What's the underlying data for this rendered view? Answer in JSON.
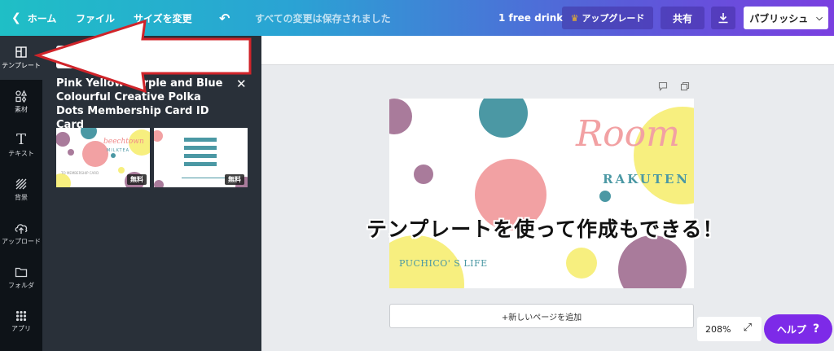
{
  "topbar": {
    "home": "ホーム",
    "file": "ファイル",
    "resize": "サイズを変更",
    "saved_status": "すべての変更は保存されました",
    "free_drink": "1 free drink",
    "upgrade": "アップグレード",
    "share": "共有",
    "publish": "パブリッシュ"
  },
  "rail": {
    "items": [
      {
        "label": "テンプレート",
        "icon": "template-icon"
      },
      {
        "label": "素材",
        "icon": "elements-icon"
      },
      {
        "label": "テキスト",
        "icon": "text-icon"
      },
      {
        "label": "背景",
        "icon": "background-icon"
      },
      {
        "label": "アップロード",
        "icon": "upload-icon"
      },
      {
        "label": "フォルダ",
        "icon": "folder-icon"
      },
      {
        "label": "アプリ",
        "icon": "apps-icon"
      }
    ]
  },
  "panel": {
    "title": "Pink Yellow Purple and Blue Colourful Creative Polka Dots Membership Card ID Card",
    "templates": [
      {
        "brand": "beechtown",
        "sub": "MILKTEA",
        "footer": "TO MEMBERSHIP CARD",
        "badge": "無料"
      },
      {
        "badge": "無料"
      }
    ]
  },
  "canvas": {
    "card_title": "Room",
    "card_subtitle": "RAKUTEN",
    "card_footer": "PUCHICO' S LIFE",
    "overlay_caption": "テンプレートを使って作成もできる！",
    "add_page": "+新しいページを追加",
    "zoom": "208%"
  },
  "help": {
    "label": "ヘルプ",
    "icon": "?"
  },
  "colors": {
    "accent_purple": "#7d2ae8",
    "teal": "#4b98a4",
    "pink": "#f2a1a3",
    "yellow": "#f7ef7f",
    "mauve": "#a97b9b",
    "arrow_red": "#d0242a"
  }
}
